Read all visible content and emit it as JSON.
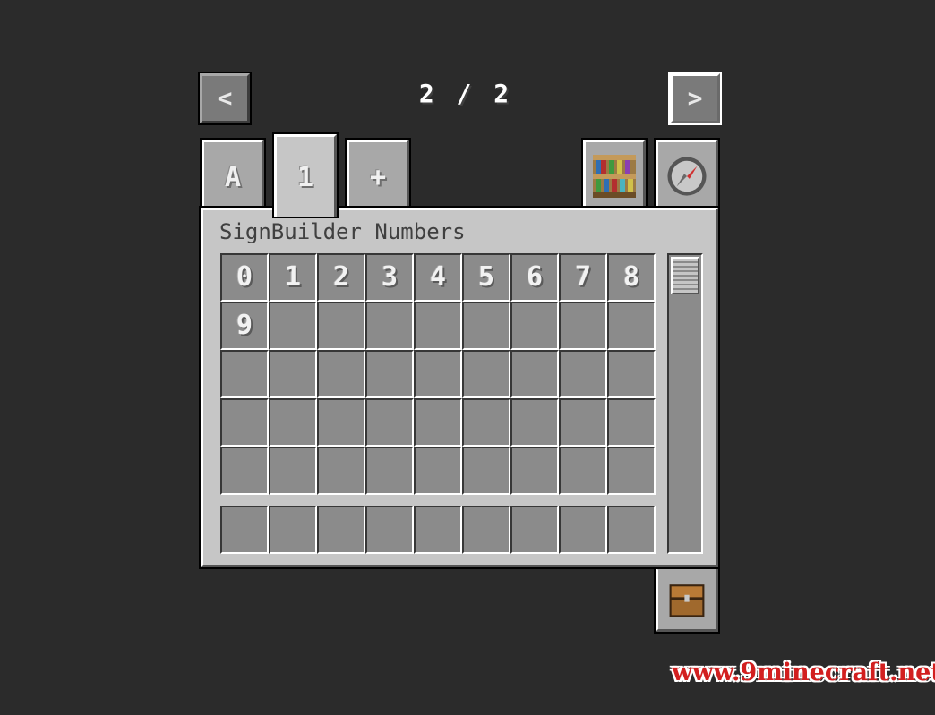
{
  "pager": {
    "prev_label": "<",
    "next_label": ">",
    "text": "2 / 2"
  },
  "tabs": [
    {
      "label": "A",
      "icon": "letter-a-icon",
      "active": false
    },
    {
      "label": "1",
      "icon": "number-one-icon",
      "active": true
    },
    {
      "label": "+",
      "icon": "symbol-plus-icon",
      "active": false
    }
  ],
  "right_tabs": [
    {
      "icon": "bookshelf-icon"
    },
    {
      "icon": "compass-icon"
    }
  ],
  "bottom_tab": {
    "icon": "chest-icon"
  },
  "panel": {
    "title": "SignBuilder Numbers"
  },
  "grid": {
    "rows": 5,
    "cols": 9,
    "items": [
      "0",
      "1",
      "2",
      "3",
      "4",
      "5",
      "6",
      "7",
      "8",
      "9"
    ]
  },
  "hotbar": {
    "slots": 9
  },
  "watermark": "www.9minecraft.net",
  "colors": {
    "background": "#2b2b2b",
    "panel": "#c6c6c6",
    "slot": "#8b8b8b",
    "watermark": "#d21f1f"
  }
}
